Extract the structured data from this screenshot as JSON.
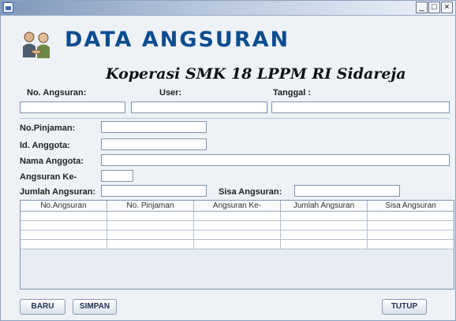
{
  "window": {
    "controls": {
      "minimize": "_",
      "maximize": "□",
      "close": "×"
    }
  },
  "header": {
    "title": "DATA ANGSURAN",
    "subtitle": "Koperasi SMK 18 LPPM RI Sidareja"
  },
  "top_fields": {
    "no_angsuran": {
      "label": "No. Angsuran:",
      "value": ""
    },
    "user": {
      "label": "User:",
      "value": ""
    },
    "tanggal": {
      "label": "Tanggal :",
      "value": ""
    }
  },
  "form": {
    "no_pinjaman": {
      "label": "No.Pinjaman:",
      "value": ""
    },
    "id_anggota": {
      "label": "Id. Anggota:",
      "value": ""
    },
    "nama_anggota": {
      "label": "Nama Anggota:",
      "value": ""
    },
    "angsuran_ke": {
      "label": "Angsuran Ke-",
      "value": ""
    },
    "jumlah_angsuran": {
      "label": "Jumlah Angsuran:",
      "value": ""
    },
    "sisa_angsuran": {
      "label": "Sisa Angsuran:",
      "value": ""
    }
  },
  "table": {
    "columns": [
      "No.Angsuran",
      "No. Pinjaman",
      "Angsuran Ke-",
      "Jumlah Angsuran",
      "Sisa Angsuran"
    ]
  },
  "buttons": {
    "baru": "BARU",
    "simpan": "SIMPAN",
    "tutup": "TUTUP"
  }
}
